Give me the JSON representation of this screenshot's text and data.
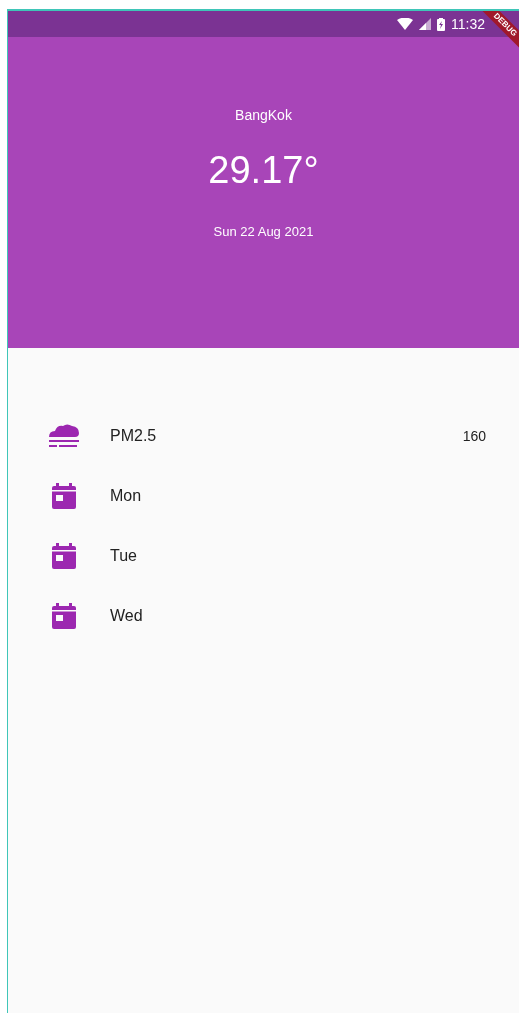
{
  "status_bar": {
    "time": "11:32"
  },
  "debug_banner": "DEBUG",
  "header": {
    "city": "BangKok",
    "temperature": "29.17°",
    "date": "Sun 22 Aug 2021"
  },
  "items": [
    {
      "kind": "air",
      "label": "PM2.5",
      "value": "160"
    },
    {
      "kind": "day",
      "label": "Mon"
    },
    {
      "kind": "day",
      "label": "Tue"
    },
    {
      "kind": "day",
      "label": "Wed"
    }
  ]
}
